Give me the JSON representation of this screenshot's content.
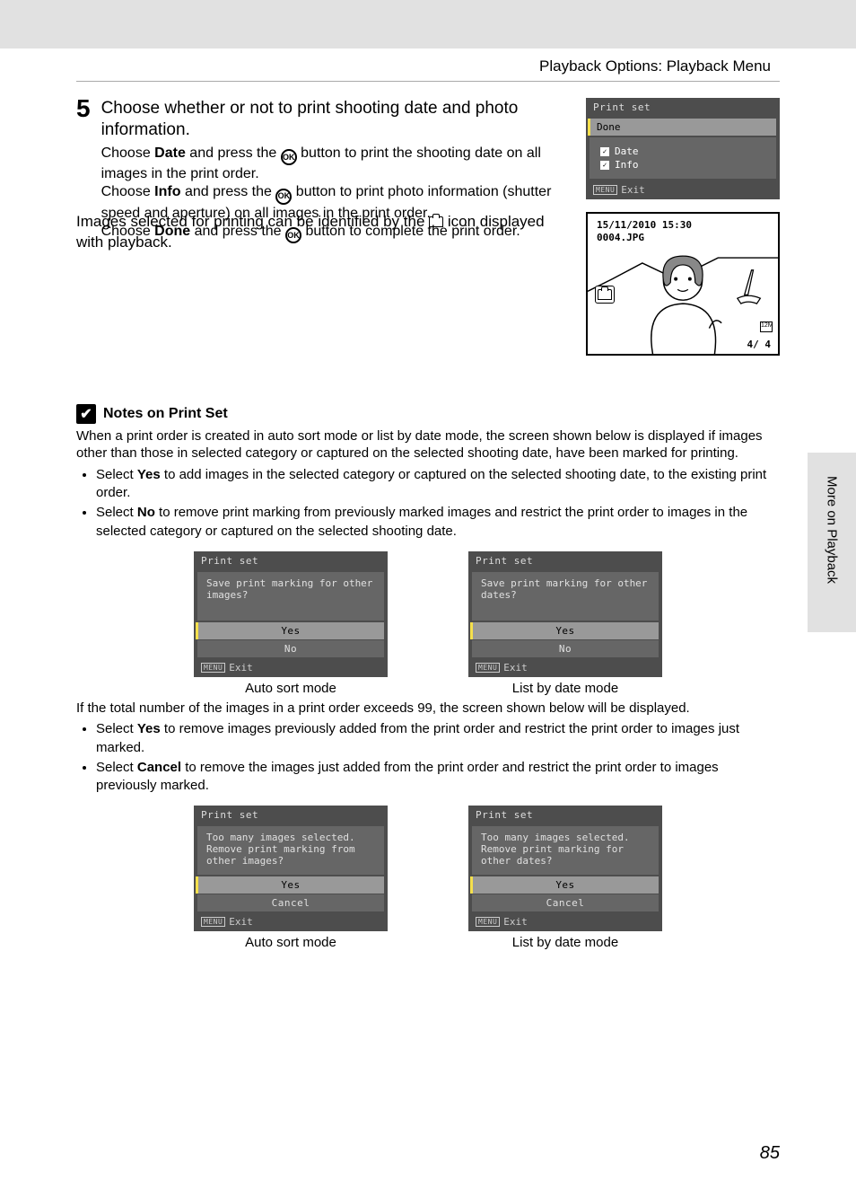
{
  "header": {
    "title": "Playback Options: Playback Menu"
  },
  "step": {
    "number": "5",
    "title": "Choose whether or not to print shooting date and photo information.",
    "p1a": "Choose ",
    "p1b": "Date",
    "p1c": " and press the ",
    "p1d": " button to print the shooting date on all images in the print order.",
    "p2a": "Choose ",
    "p2b": "Info",
    "p2c": " and press the ",
    "p2d": " button to print photo information (shutter speed and aperture) on all images in the print order.",
    "p3a": "Choose ",
    "p3b": "Done",
    "p3c": " and press the ",
    "p3d": " button to complete the print order.",
    "ok": "OK"
  },
  "printset_screen": {
    "title": "Print set",
    "done": "Done",
    "date": "Date",
    "info": "Info",
    "menu": "MENU",
    "exit": "Exit"
  },
  "followup": {
    "a": "Images selected for printing can be identified by the ",
    "b": " icon displayed with playback."
  },
  "preview": {
    "date": "15/11/2010 15:30",
    "file": "0004.JPG",
    "count": "4/     4",
    "res": "12M"
  },
  "notes": {
    "check": "✔",
    "title": "Notes on Print Set",
    "intro": "When a print order is created in auto sort mode or list by date mode, the screen shown below is displayed if images other than those in selected category or captured on the selected shooting date, have been marked for printing.",
    "b1a": "Select ",
    "b1b": "Yes",
    "b1c": " to add images in the selected category or captured on the selected shooting date, to the existing print order.",
    "b2a": "Select ",
    "b2b": "No",
    "b2c": " to remove print marking from previously marked images and restrict the print order to images in the selected category or captured on the selected shooting date."
  },
  "dialogs1": {
    "left": {
      "title": "Print set",
      "msg": "Save print marking for other images?",
      "yes": "Yes",
      "no": "No",
      "menu": "MENU",
      "exit": "Exit",
      "cap": "Auto sort mode"
    },
    "right": {
      "title": "Print set",
      "msg": "Save print marking for other dates?",
      "yes": "Yes",
      "no": "No",
      "menu": "MENU",
      "exit": "Exit",
      "cap": "List by date mode"
    }
  },
  "notes2": {
    "intro": "If the total number of the images in a print order exceeds 99, the screen shown below will be displayed.",
    "b1a": "Select ",
    "b1b": "Yes",
    "b1c": " to remove images previously added from the print order and restrict the print order to images just marked.",
    "b2a": "Select ",
    "b2b": "Cancel",
    "b2c": " to remove the images just added from the print order and restrict the print order to images previously marked."
  },
  "dialogs2": {
    "left": {
      "title": "Print set",
      "msg": "Too many images selected. Remove print marking from other images?",
      "yes": "Yes",
      "cancel": "Cancel",
      "menu": "MENU",
      "exit": "Exit",
      "cap": "Auto sort mode"
    },
    "right": {
      "title": "Print set",
      "msg": "Too many images selected. Remove print marking for other dates?",
      "yes": "Yes",
      "cancel": "Cancel",
      "menu": "MENU",
      "exit": "Exit",
      "cap": "List by date mode"
    }
  },
  "side_tab": "More on Playback",
  "page_num": "85"
}
